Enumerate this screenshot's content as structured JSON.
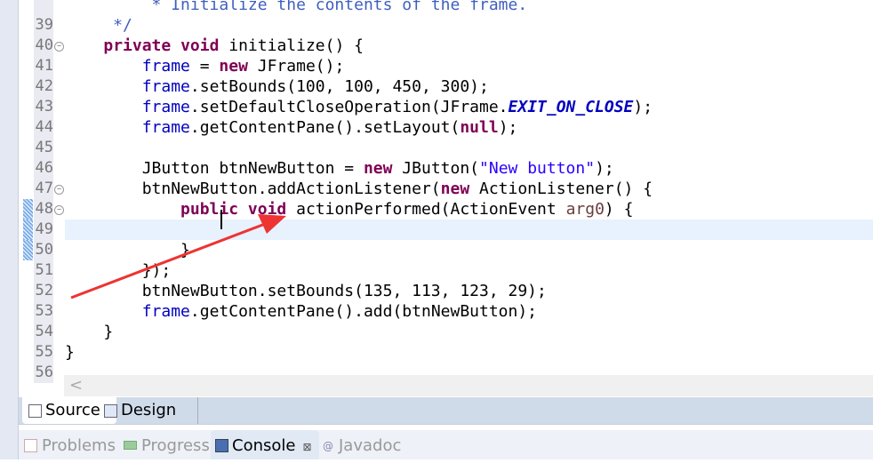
{
  "editor": {
    "first_line": 39,
    "current_line": 49,
    "lines": [
      {
        "n": "",
        "t": [
          [
            "         * Initialize the contents of the frame.",
            "c"
          ]
        ]
      },
      {
        "n": "39",
        "t": [
          [
            "     */",
            "c"
          ]
        ]
      },
      {
        "n": "40",
        "fold": true,
        "t": [
          [
            "    ",
            ""
          ],
          [
            "private",
            "k"
          ],
          [
            " ",
            ""
          ],
          [
            "void",
            "k"
          ],
          [
            " initialize() {",
            ""
          ]
        ]
      },
      {
        "n": "41",
        "t": [
          [
            "        ",
            ""
          ],
          [
            "frame",
            "f"
          ],
          [
            " = ",
            ""
          ],
          [
            "new",
            "k"
          ],
          [
            " JFrame();",
            ""
          ]
        ]
      },
      {
        "n": "42",
        "t": [
          [
            "        ",
            ""
          ],
          [
            "frame",
            "f"
          ],
          [
            ".setBounds(100, 100, 450, 300);",
            ""
          ]
        ]
      },
      {
        "n": "43",
        "t": [
          [
            "        ",
            ""
          ],
          [
            "frame",
            "f"
          ],
          [
            ".setDefaultCloseOperation(JFrame.",
            ""
          ],
          [
            "EXIT_ON_CLOSE",
            "fi"
          ],
          [
            ");",
            ""
          ]
        ]
      },
      {
        "n": "44",
        "t": [
          [
            "        ",
            ""
          ],
          [
            "frame",
            "f"
          ],
          [
            ".getContentPane().setLayout(",
            ""
          ],
          [
            "null",
            "k"
          ],
          [
            ");",
            ""
          ]
        ]
      },
      {
        "n": "45",
        "t": []
      },
      {
        "n": "46",
        "t": [
          [
            "        JButton btnNewButton = ",
            ""
          ],
          [
            "new",
            "k"
          ],
          [
            " JButton(",
            ""
          ],
          [
            "\"New button\"",
            "s"
          ],
          [
            ");",
            ""
          ]
        ]
      },
      {
        "n": "47",
        "fold": true,
        "t": [
          [
            "        btnNewButton.addActionListener(",
            ""
          ],
          [
            "new",
            "k"
          ],
          [
            " ActionListener() {",
            ""
          ]
        ]
      },
      {
        "n": "48",
        "fold": true,
        "diff": true,
        "t": [
          [
            "            ",
            ""
          ],
          [
            "public",
            "k"
          ],
          [
            " ",
            ""
          ],
          [
            "void",
            "k"
          ],
          [
            " actionPerformed(ActionEvent ",
            ""
          ],
          [
            "arg0",
            "p"
          ],
          [
            ") {",
            ""
          ]
        ]
      },
      {
        "n": "49",
        "diff": true,
        "t": []
      },
      {
        "n": "50",
        "diff": true,
        "t": [
          [
            "            }",
            ""
          ]
        ]
      },
      {
        "n": "51",
        "t": [
          [
            "        });",
            ""
          ]
        ]
      },
      {
        "n": "52",
        "t": [
          [
            "        btnNewButton.setBounds(135, 113, 123, 29);",
            ""
          ]
        ]
      },
      {
        "n": "53",
        "t": [
          [
            "        ",
            ""
          ],
          [
            "frame",
            "f"
          ],
          [
            ".getContentPane().add(btnNewButton);",
            ""
          ]
        ]
      },
      {
        "n": "54",
        "t": [
          [
            "    }",
            ""
          ]
        ]
      },
      {
        "n": "55",
        "t": [
          [
            "}",
            ""
          ]
        ]
      },
      {
        "n": "56",
        "t": []
      }
    ]
  },
  "hscroll": {
    "left_arrow": "<"
  },
  "editor_tabs": [
    {
      "label": "Source",
      "icon": "source-icon",
      "active": true
    },
    {
      "label": "Design",
      "icon": "design-icon",
      "active": false
    }
  ],
  "panel_tabs": [
    {
      "label": "Problems",
      "icon": "problems-icon",
      "active": false
    },
    {
      "label": "Progress",
      "icon": "progress-icon",
      "active": false
    },
    {
      "label": "Console",
      "icon": "console-icon",
      "active": true,
      "close": "⊠"
    },
    {
      "label": "Javadoc",
      "icon": "javadoc-icon",
      "active": false,
      "glyph": "@"
    }
  ],
  "colors": {
    "keyword": "#7f0055",
    "field": "#0000c0",
    "string": "#2a00ff",
    "param": "#6a3e3e",
    "comment": "#3f5fbf",
    "current_line": "#e8f2fe",
    "annotation_arrow": "#ee3333"
  }
}
